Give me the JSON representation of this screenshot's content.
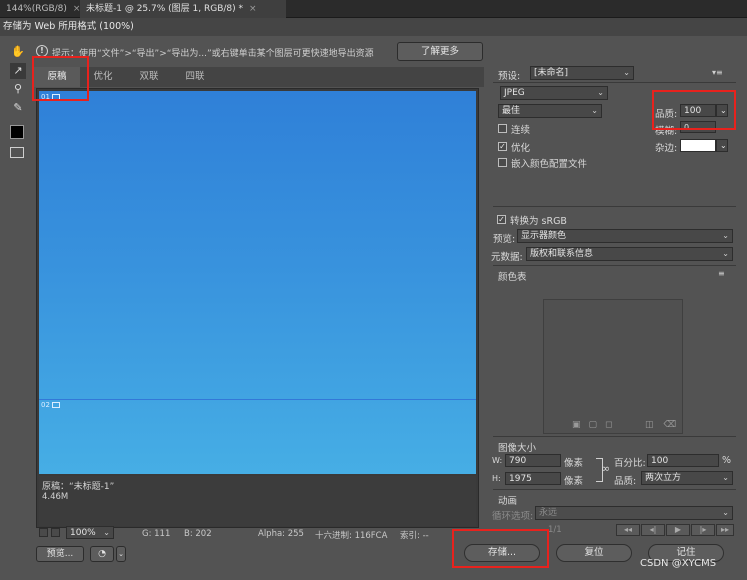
{
  "ps_tabs": [
    {
      "label": "144%(RGB/8)",
      "close": "×"
    },
    {
      "label": "未标题-1 @ 25.7% (图层 1, RGB/8) *",
      "close": "×"
    }
  ],
  "dialog": {
    "title": "存储为 Web 所用格式 (100%)",
    "hint_text": "提示：使用“文件”>“导出”>“导出为...”或右键单击某个图层可更快速地导出资源",
    "learn_more": "了解更多"
  },
  "view_tabs": [
    "原稿",
    "优化",
    "双联",
    "四联"
  ],
  "preview": {
    "slice1": "01",
    "slice2": "02",
    "info_name": "原稿：“未标题-1”",
    "info_size": "4.46M"
  },
  "status": {
    "zoom": "100%",
    "g": "G: 111",
    "b": "B: 202",
    "alpha": "Alpha: 255",
    "hex": "十六进制: 116FCA",
    "index": "索引: --"
  },
  "bottom_buttons": {
    "preview": "预览...",
    "save": "存储...",
    "reset": "复位",
    "remember": "记住"
  },
  "settings": {
    "preset_label": "预设:",
    "preset_value": "[未命名]",
    "format": "JPEG",
    "quality_preset": "最佳",
    "quality_label": "品质:",
    "quality_value": "100",
    "blur_label": "模糊:",
    "blur_value": "0",
    "progressive": "连续",
    "optimized": "优化",
    "embed_profile": "嵌入颜色配置文件",
    "matte_label": "杂边:"
  },
  "color": {
    "convert_srgb": "转换为 sRGB",
    "preview_label": "预览:",
    "preview_value": "显示器颜色",
    "metadata_label": "元数据:",
    "metadata_value": "版权和联系信息",
    "color_table_title": "颜色表"
  },
  "image_size": {
    "title": "图像大小",
    "w_label": "W:",
    "w_value": "790",
    "h_label": "H:",
    "h_value": "1975",
    "unit": "像素",
    "percent_label": "百分比:",
    "percent_value": "100",
    "percent_unit": "%",
    "quality_label": "品质:",
    "quality_value": "两次立方"
  },
  "animation": {
    "title": "动画",
    "loop_label": "循环选项:",
    "loop_value": "永远",
    "frame": "1/1"
  },
  "watermark": "CSDN @XYCMS",
  "colors": {
    "highlight": "#e8221d",
    "canvas_top": "#2f80d8",
    "canvas_bottom": "#46aee5"
  }
}
